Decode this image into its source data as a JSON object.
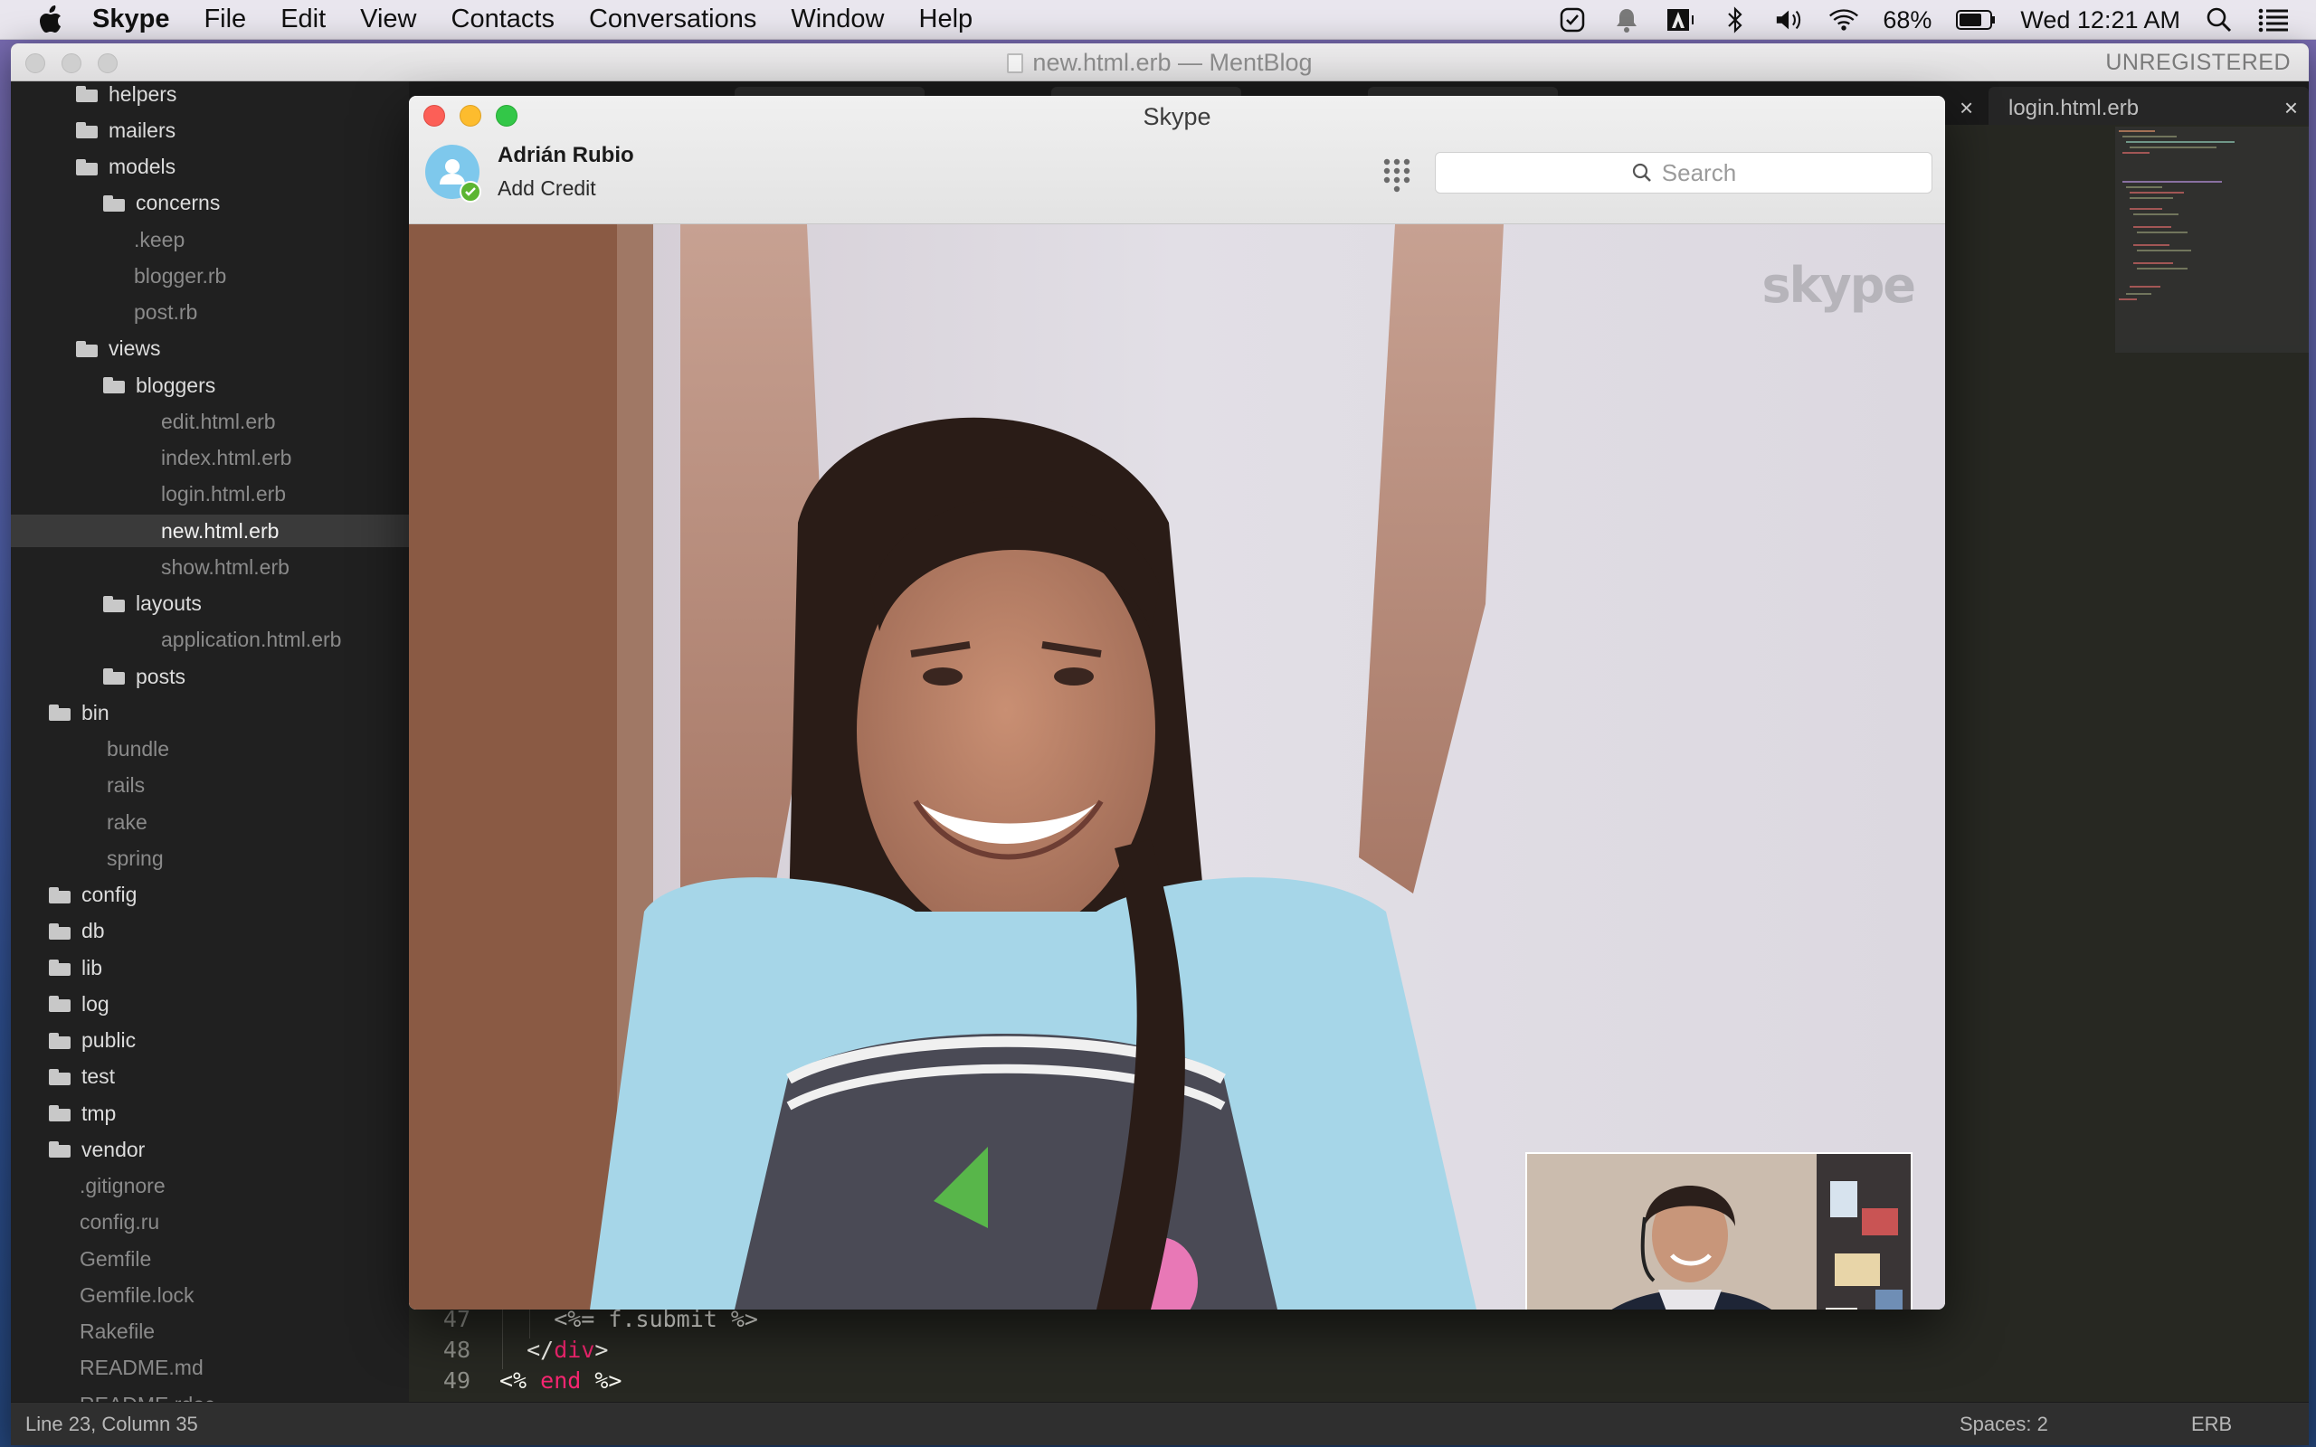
{
  "menubar": {
    "app_name": "Skype",
    "items": [
      "File",
      "Edit",
      "View",
      "Contacts",
      "Conversations",
      "Window",
      "Help"
    ],
    "battery": "68%",
    "clock": "Wed 12:21 AM",
    "icons": [
      "apple-icon",
      "checkmark-icon",
      "notification-bell-icon",
      "adobe-icon",
      "bluetooth-icon",
      "volume-icon",
      "wifi-icon",
      "battery-icon",
      "spotlight-search-icon",
      "notification-center-icon"
    ]
  },
  "editor": {
    "title": "new.html.erb — MentBlog",
    "registration": "UNREGISTERED",
    "tabs": [
      {
        "label": "login.html.erb",
        "close": "×"
      }
    ],
    "hidden_tab_close": "×",
    "sidebar": [
      {
        "label": "helpers",
        "type": "folder",
        "depth": 1
      },
      {
        "label": "mailers",
        "type": "folder",
        "depth": 1
      },
      {
        "label": "models",
        "type": "folder",
        "depth": 1
      },
      {
        "label": "concerns",
        "type": "folder",
        "depth": 2
      },
      {
        "label": ".keep",
        "type": "file",
        "depth": 3
      },
      {
        "label": "blogger.rb",
        "type": "file",
        "depth": 2
      },
      {
        "label": "post.rb",
        "type": "file",
        "depth": 2
      },
      {
        "label": "views",
        "type": "folder",
        "depth": 1
      },
      {
        "label": "bloggers",
        "type": "folder",
        "depth": 2
      },
      {
        "label": "edit.html.erb",
        "type": "file",
        "depth": 3
      },
      {
        "label": "index.html.erb",
        "type": "file",
        "depth": 3
      },
      {
        "label": "login.html.erb",
        "type": "file",
        "depth": 3
      },
      {
        "label": "new.html.erb",
        "type": "file",
        "depth": 3,
        "selected": true
      },
      {
        "label": "show.html.erb",
        "type": "file",
        "depth": 3
      },
      {
        "label": "layouts",
        "type": "folder",
        "depth": 2
      },
      {
        "label": "application.html.erb",
        "type": "file",
        "depth": 3
      },
      {
        "label": "posts",
        "type": "folder",
        "depth": 2
      },
      {
        "label": "bin",
        "type": "folder",
        "depth": 0
      },
      {
        "label": "bundle",
        "type": "file",
        "depth": 1
      },
      {
        "label": "rails",
        "type": "file",
        "depth": 1
      },
      {
        "label": "rake",
        "type": "file",
        "depth": 1
      },
      {
        "label": "spring",
        "type": "file",
        "depth": 1
      },
      {
        "label": "config",
        "type": "folder",
        "depth": 0
      },
      {
        "label": "db",
        "type": "folder",
        "depth": 0
      },
      {
        "label": "lib",
        "type": "folder",
        "depth": 0
      },
      {
        "label": "log",
        "type": "folder",
        "depth": 0
      },
      {
        "label": "public",
        "type": "folder",
        "depth": 0
      },
      {
        "label": "test",
        "type": "folder",
        "depth": 0
      },
      {
        "label": "tmp",
        "type": "folder",
        "depth": 0
      },
      {
        "label": "vendor",
        "type": "folder",
        "depth": 0
      },
      {
        "label": ".gitignore",
        "type": "file",
        "depth": 0
      },
      {
        "label": "config.ru",
        "type": "file",
        "depth": 0
      },
      {
        "label": "Gemfile",
        "type": "file",
        "depth": 0
      },
      {
        "label": "Gemfile.lock",
        "type": "file",
        "depth": 0
      },
      {
        "label": "Rakefile",
        "type": "file",
        "depth": 0
      },
      {
        "label": "README.md",
        "type": "file",
        "depth": 0
      },
      {
        "label": "README.rdoc",
        "type": "file",
        "depth": 0
      }
    ],
    "code": [
      {
        "line": "47",
        "parts": [
          [
            "erb",
            "    <%= f.submit %>"
          ]
        ]
      },
      {
        "line": "48",
        "parts": [
          [
            "erb",
            "  </"
          ],
          [
            "tagc",
            "div"
          ],
          [
            "erb",
            ">"
          ]
        ]
      },
      {
        "line": "49",
        "parts": [
          [
            "erb",
            "<% "
          ],
          [
            "kw",
            "end"
          ],
          [
            "erb",
            " %>"
          ]
        ]
      }
    ],
    "status": {
      "position": "Line 23, Column 35",
      "spaces": "Spaces: 2",
      "syntax": "ERB"
    }
  },
  "skype": {
    "window_title": "Skype",
    "user_name": "Adrián Rubio",
    "credit_link": "Add Credit",
    "search_placeholder": "Search",
    "watermark": "skype",
    "colors": {
      "close": "#fc5f57",
      "minimize": "#fdbc2e",
      "zoom": "#33c748",
      "avatar": "#7ec8ec",
      "online": "#5cb531"
    }
  }
}
